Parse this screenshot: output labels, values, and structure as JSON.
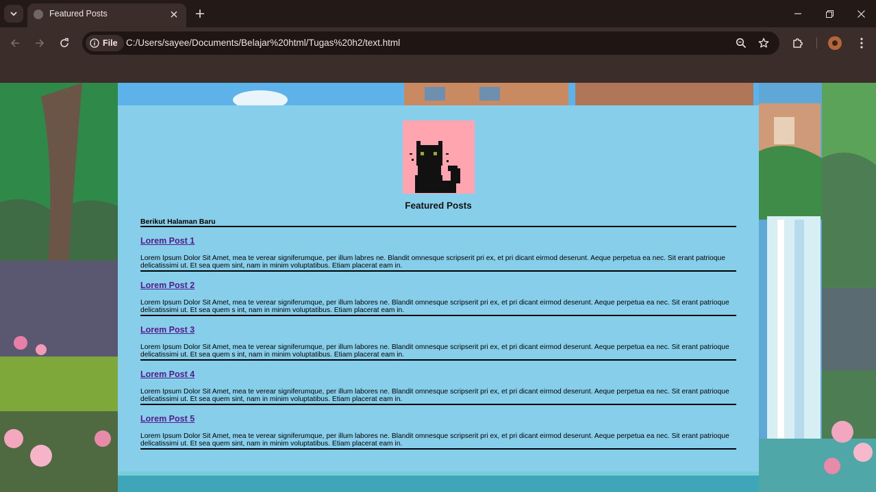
{
  "browser": {
    "tab_title": "Featured Posts",
    "url_chip": "File",
    "url": "C:/Users/sayee/Documents/Belajar%20html/Tugas%20h2/text.html"
  },
  "page": {
    "title": "Featured Posts",
    "intro": "Berikut Halaman Baru",
    "posts": [
      {
        "title": "Lorem Post 1",
        "body": "Lorem Ipsum Dolor Sit Amet, mea te verear signiferumque, per illum labres ne. Blandit omnesque scripserit pri ex, et pri dicant eirmod deserunt. Aeque perpetua ea nec. Sit erant patrioque delicatissimi ut. Et sea quem sint, nam in minim voluptatibus. Etiam placerat eam in."
      },
      {
        "title": "Lorem Post 2",
        "body": "Lorem Ipsum Dolor Sit Amet, mea te verear signiferumque, per illum labores ne. Blandit omnesque scripserit pri ex, et pri dicant eirmod deserunt. Aeque perpetua ea nec. Sit erant patrioque delicatissimi ut. Et sea quem s int, nam in minim voluptatibus. Etiam placerat eam in."
      },
      {
        "title": "Lorem Post 3",
        "body": "Lorem Ipsum Dolor Sit Amet, mea te verear signiferumque, per illum labores ne. Blandit omnesque scripserit pri ex, et pri dicant eirmod deserunt. Aeque perpetua ea nec. Sit erant patrioque delicatissimi ut. Et sea quem s int, nam in minim voluptatibus. Etiam placerat eam in."
      },
      {
        "title": "Lorem Post 4",
        "body": "Lorem Ipsum Dolor Sit Amet, mea te verear signiferumque, per illum labores ne. Blandit omnesque scripserit pri ex, et pri dicant eirmod deserunt. Aeque perpetua ea nec. Sit erant patrioque delicatissimi ut. Et sea quem sint, nam in minim voluptatibus. Etiam placerat eam in."
      },
      {
        "title": "Lorem Post 5",
        "body": "Lorem Ipsum Dolor Sit Amet, mea te verear signiferumque, per illum labores ne. Blandit omnesque scripserit pri ex, et pri dicant eirmod deserunt. Aeque perpetua ea nec. Sit erant patrioque delicatissimi ut. Et sea quem sint, nam in minim voluptatibus. Etiam placerat eam in."
      }
    ]
  },
  "colors": {
    "card_background": "#87ceeb",
    "link_visited": "#551a8b",
    "logo_background": "#ffa5b0"
  },
  "icons": {
    "tab_search": "chevron-down-icon",
    "favicon": "globe-icon",
    "tab_close": "close-icon",
    "new_tab": "plus-icon",
    "back": "arrow-left-icon",
    "forward": "arrow-right-icon",
    "reload": "reload-icon",
    "site_info": "info-icon",
    "zoom": "zoom-icon",
    "bookmark": "star-icon",
    "extensions": "puzzle-icon",
    "menu": "kebab-menu-icon",
    "logo": "black-cat-pixel-art"
  }
}
